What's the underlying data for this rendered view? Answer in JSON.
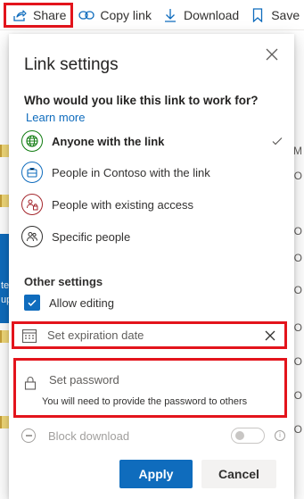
{
  "toolbar": {
    "share_label": "Share",
    "copy_link_label": "Copy link",
    "download_label": "Download",
    "save_label": "Save"
  },
  "background": {
    "column_header_letter": "M",
    "row_letters": [
      "O",
      "O",
      "O",
      "O",
      "O",
      "O",
      "O",
      "O"
    ],
    "side_text": [
      "te",
      "up"
    ]
  },
  "panel": {
    "title": "Link settings",
    "question": "Who would you like this link to work for?",
    "learn_more": "Learn more",
    "options": [
      {
        "label": "Anyone with the link",
        "icon": "globe-icon",
        "color": "#107c10",
        "selected": true
      },
      {
        "label": "People in Contoso with the link",
        "icon": "building-icon",
        "color": "#0f6cbd",
        "selected": false
      },
      {
        "label": "People with existing access",
        "icon": "people-lock-icon",
        "color": "#a4262c",
        "selected": false
      },
      {
        "label": "Specific people",
        "icon": "people-icon",
        "color": "#323130",
        "selected": false
      }
    ],
    "other_settings": "Other settings",
    "allow_editing": "Allow editing",
    "allow_editing_checked": true,
    "expiration": {
      "placeholder": "Set expiration date"
    },
    "password": {
      "placeholder": "Set password",
      "hint": "You will need to provide the password to others"
    },
    "block_download": {
      "label": "Block download",
      "enabled": false,
      "info": "i"
    },
    "apply_label": "Apply",
    "cancel_label": "Cancel"
  },
  "colors": {
    "accent": "#0f6cbd",
    "highlight": "#e3141c"
  }
}
